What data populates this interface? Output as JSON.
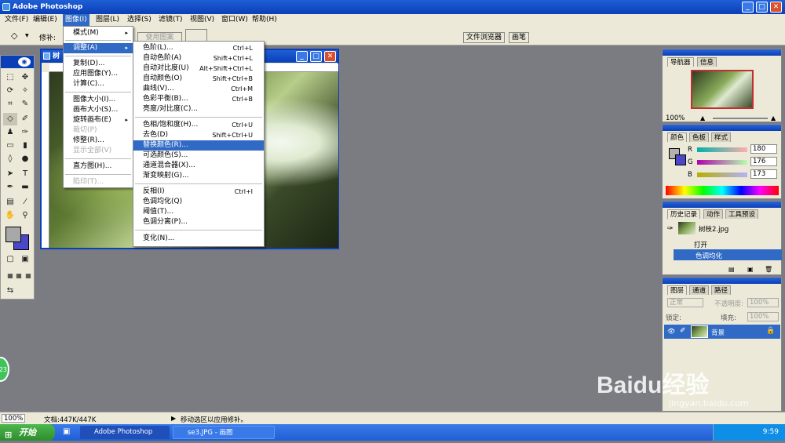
{
  "app": {
    "title": "Adobe Photoshop"
  },
  "menubar": [
    "文件(F)",
    "编辑(E)",
    "图像(I)",
    "图层(L)",
    "选择(S)",
    "滤镜(T)",
    "视图(V)",
    "窗口(W)",
    "帮助(H)"
  ],
  "options": {
    "repair_label": "修补:",
    "use_pattern": "使用图案",
    "tab_browser": "文件浏览器",
    "tab_brush": "画笔"
  },
  "document": {
    "title": "树"
  },
  "image_menu": {
    "items": [
      {
        "label": "模式(M)",
        "arrow": "▸"
      },
      {
        "label": "调整(A)",
        "arrow": "▸",
        "hl": true
      },
      {
        "label": "复制(D)..."
      },
      {
        "label": "应用图像(Y)..."
      },
      {
        "label": "计算(C)..."
      },
      {
        "label": "图像大小(I)..."
      },
      {
        "label": "画布大小(S)..."
      },
      {
        "label": "旋转画布(E)",
        "arrow": "▸"
      },
      {
        "label": "裁切(P)",
        "dis": true
      },
      {
        "label": "修整(R)..."
      },
      {
        "label": "显示全部(V)",
        "dis": true
      },
      {
        "label": "直方图(H)..."
      },
      {
        "label": "陷印(T)...",
        "dis": true
      }
    ]
  },
  "adjust_menu": {
    "items": [
      {
        "label": "色阶(L)...",
        "sc": "Ctrl+L"
      },
      {
        "label": "自动色阶(A)",
        "sc": "Shift+Ctrl+L"
      },
      {
        "label": "自动对比度(U)",
        "sc": "Alt+Shift+Ctrl+L"
      },
      {
        "label": "自动颜色(O)",
        "sc": "Shift+Ctrl+B"
      },
      {
        "label": "曲线(V)...",
        "sc": "Ctrl+M"
      },
      {
        "label": "色彩平衡(B)...",
        "sc": "Ctrl+B"
      },
      {
        "label": "亮度/对比度(C)..."
      },
      {
        "label": "色相/饱和度(H)...",
        "sc": "Ctrl+U"
      },
      {
        "label": "去色(D)",
        "sc": "Shift+Ctrl+U"
      },
      {
        "label": "替换颜色(R)...",
        "hl": true
      },
      {
        "label": "可选颜色(S)..."
      },
      {
        "label": "通道混合器(X)..."
      },
      {
        "label": "渐变映射(G)..."
      },
      {
        "label": "反相(I)",
        "sc": "Ctrl+I"
      },
      {
        "label": "色调均化(Q)"
      },
      {
        "label": "阈值(T)..."
      },
      {
        "label": "色调分离(P)..."
      },
      {
        "label": "变化(N)..."
      }
    ]
  },
  "navigator": {
    "tab1": "导航器",
    "tab2": "信息",
    "zoom": "100%"
  },
  "color": {
    "tab1": "颜色",
    "tab2": "色板",
    "tab3": "样式",
    "r_label": "R",
    "g_label": "G",
    "b_label": "B",
    "r": "180",
    "g": "176",
    "b": "173"
  },
  "history": {
    "tab1": "历史记录",
    "tab2": "动作",
    "tab3": "工具预设",
    "file": "树枝2.jpg",
    "step1": "打开",
    "step2": "色调均化"
  },
  "layers": {
    "tab1": "图层",
    "tab2": "通道",
    "tab3": "路径",
    "mode": "正常",
    "opacity_label": "不透明度:",
    "opacity": "100%",
    "lock_label": "锁定:",
    "fill_label": "填充:",
    "fill": "100%",
    "layer_name": "背景"
  },
  "status": {
    "zoom": "100%",
    "doc": "文档:447K/447K",
    "hint": "移动选区以应用修补。"
  },
  "taskbar": {
    "start": "开始",
    "task1": "Adobe Photoshop",
    "task2": "se3.JPG - 画图",
    "time": "9:59"
  },
  "watermark": {
    "logo": "Baidu经验",
    "url": "jingyan.baidu.com"
  },
  "circle_badge": "23"
}
